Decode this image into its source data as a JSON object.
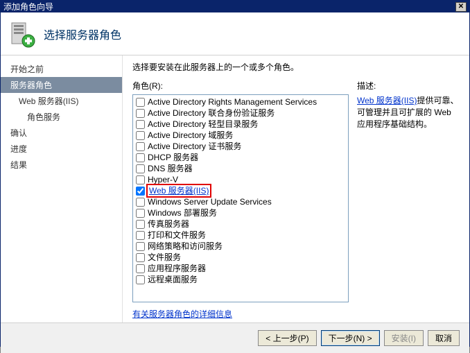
{
  "window": {
    "title": "添加角色向导"
  },
  "header": {
    "title": "选择服务器角色"
  },
  "sidebar": {
    "items": [
      {
        "label": "开始之前",
        "indent": 0,
        "selected": false
      },
      {
        "label": "服务器角色",
        "indent": 0,
        "selected": true
      },
      {
        "label": "Web 服务器(IIS)",
        "indent": 1,
        "selected": false
      },
      {
        "label": "角色服务",
        "indent": 2,
        "selected": false
      },
      {
        "label": "确认",
        "indent": 0,
        "selected": false
      },
      {
        "label": "进度",
        "indent": 0,
        "selected": false
      },
      {
        "label": "结果",
        "indent": 0,
        "selected": false
      }
    ]
  },
  "main": {
    "instruction": "选择要安装在此服务器上的一个或多个角色。",
    "roles_label": "角色(R):",
    "desc_label": "描述:",
    "desc_link": "Web 服务器(IIS)",
    "desc_text": "提供可靠、可管理并且可扩展的 Web 应用程序基础结构。",
    "more_link": "有关服务器角色的详细信息",
    "roles": [
      {
        "label": "Active Directory Rights Management Services",
        "checked": false,
        "highlight": false
      },
      {
        "label": "Active Directory 联合身份验证服务",
        "checked": false,
        "highlight": false
      },
      {
        "label": "Active Directory 轻型目录服务",
        "checked": false,
        "highlight": false
      },
      {
        "label": "Active Directory 域服务",
        "checked": false,
        "highlight": false
      },
      {
        "label": "Active Directory 证书服务",
        "checked": false,
        "highlight": false
      },
      {
        "label": "DHCP 服务器",
        "checked": false,
        "highlight": false
      },
      {
        "label": "DNS 服务器",
        "checked": false,
        "highlight": false
      },
      {
        "label": "Hyper-V",
        "checked": false,
        "highlight": false
      },
      {
        "label": "Web 服务器(IIS)",
        "checked": true,
        "highlight": true,
        "blue": true
      },
      {
        "label": "Windows Server Update Services",
        "checked": false,
        "highlight": false
      },
      {
        "label": "Windows 部署服务",
        "checked": false,
        "highlight": false
      },
      {
        "label": "传真服务器",
        "checked": false,
        "highlight": false
      },
      {
        "label": "打印和文件服务",
        "checked": false,
        "highlight": false
      },
      {
        "label": "网络策略和访问服务",
        "checked": false,
        "highlight": false
      },
      {
        "label": "文件服务",
        "checked": false,
        "highlight": false
      },
      {
        "label": "应用程序服务器",
        "checked": false,
        "highlight": false
      },
      {
        "label": "远程桌面服务",
        "checked": false,
        "highlight": false
      }
    ]
  },
  "footer": {
    "prev": "< 上一步(P)",
    "next": "下一步(N) >",
    "install": "安装(I)",
    "cancel": "取消"
  }
}
